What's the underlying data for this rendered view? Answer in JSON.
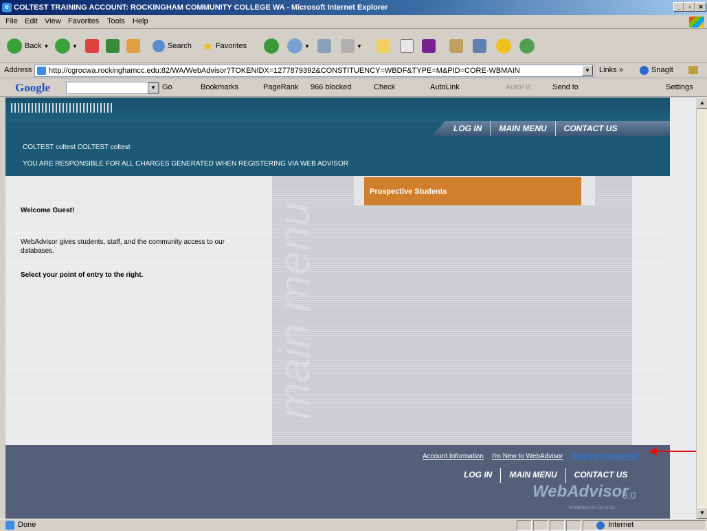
{
  "window": {
    "title": "COLTEST TRAINING ACCOUNT: ROCKINGHAM COMMUNITY COLLEGE WA - Microsoft Internet Explorer",
    "controls": {
      "minimize": "_",
      "restore": "▫",
      "close": "✕"
    }
  },
  "menubar": {
    "items": [
      {
        "label": "File"
      },
      {
        "label": "Edit"
      },
      {
        "label": "View"
      },
      {
        "label": "Favorites"
      },
      {
        "label": "Tools"
      },
      {
        "label": "Help"
      }
    ]
  },
  "toolbar": {
    "back_label": "Back",
    "search_label": "Search",
    "favorites_label": "Favorites"
  },
  "addressbar": {
    "label": "Address",
    "url": "http://cgrocwa.rockinghamcc.edu:82/WA/WebAdvisor?TOKENIDX=1277879392&CONSTITUENCY=WBDF&TYPE=M&PID=CORE-WBMAIN",
    "links_label": "Links »",
    "snagit_label": "SnagIt"
  },
  "googlebar": {
    "logo": "Google",
    "go_label": "Go",
    "bookmarks_label": "Bookmarks",
    "pagerank_label": "PageRank",
    "blocked_label": "966 blocked",
    "check_label": "Check",
    "autolink_label": "AutoLink",
    "autofill_label": "AutoFill",
    "sendto_label": "Send to",
    "settings_label": "Settings"
  },
  "page": {
    "nav": {
      "login": "LOG IN",
      "main_menu": "MAIN MENU",
      "contact_us": "CONTACT US"
    },
    "user_line": "COLTEST coltest COLTEST coltest",
    "warning_line": "YOU ARE RESPONSIBLE FOR ALL CHARGES GENERATED WHEN REGISTERING VIA WEB ADVISOR",
    "big_word": "main menu",
    "prospective_students": "Prospective Students",
    "welcome": "Welcome Guest!",
    "intro": "WebAdvisor gives students, staff, and the community access to our databases.",
    "select": "Select your point of entry to the right.",
    "footer_links": {
      "account_info": "Account Information",
      "new_user": "I'm New to WebAdvisor",
      "password": "What's My Password?"
    },
    "logo": {
      "name": "WebAdvisor",
      "version": "3.0",
      "powered": "POWERED BY DATATEL"
    }
  },
  "statusbar": {
    "status": "Done",
    "zone": "Internet"
  },
  "colors": {
    "header": "#1c5977",
    "accent": "#d07f2c",
    "footer": "#54607a",
    "link_highlight": "#2a7ff0"
  }
}
